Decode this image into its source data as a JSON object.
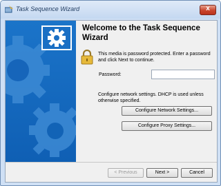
{
  "window": {
    "title": "Task Sequence Wizard",
    "close_label": "x"
  },
  "page": {
    "heading": "Welcome to the Task Sequence Wizard",
    "password_message": "This media is password protected.  Enter a password and click Next to continue.",
    "password_label": "Password:",
    "password_value": "",
    "network_message": "Configure network settings. DHCP is used unless otherwise specified.",
    "configure_network_label": "Configure Network Settings...",
    "configure_proxy_label": "Configure Proxy Settings..."
  },
  "footer": {
    "previous_label": "< Previous",
    "next_label": "Next >",
    "cancel_label": "Cancel"
  },
  "icons": {
    "title_icon": "wizard-icon",
    "banner_logo": "gear-icon",
    "lock": "padlock-icon"
  },
  "colors": {
    "banner_blue": "#1b74c9",
    "close_red": "#c9452d"
  }
}
